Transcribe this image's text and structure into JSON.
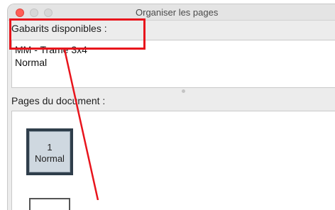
{
  "window": {
    "title": "Organiser les pages"
  },
  "templates": {
    "label": "Gabarits disponibles :",
    "items": [
      {
        "label": "MM - Trame 3x4"
      },
      {
        "label": "Normal"
      }
    ]
  },
  "pages": {
    "label": "Pages du document :",
    "items": [
      {
        "number": "1",
        "template": "Normal"
      }
    ]
  },
  "annotation": {
    "color": "#e8141c"
  }
}
